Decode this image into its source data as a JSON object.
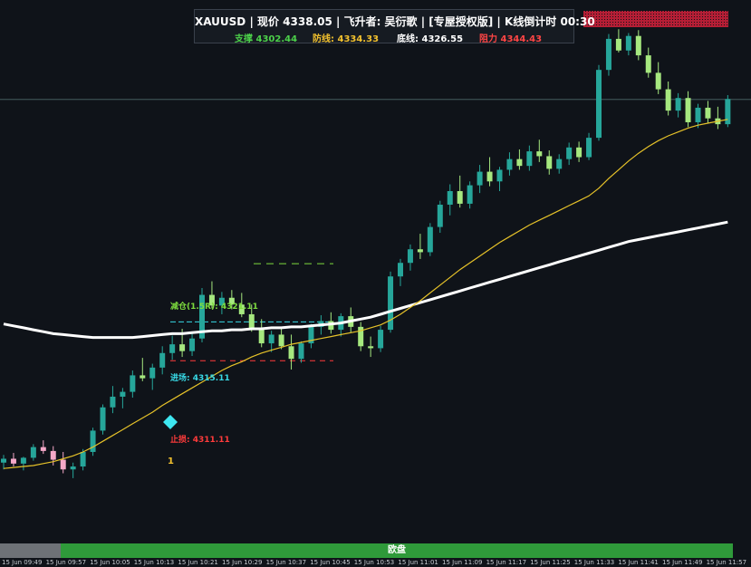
{
  "header": {
    "title": "XAUUSD | 现价 4338.05 | 飞升者: 吴衍歌 | [专屋授权版] | K线倒计时 00:30",
    "support": "支撑 4302.44",
    "defense": "防线: 4334.33",
    "bottom": "底线: 4326.55",
    "resistance": "阻力 4344.43"
  },
  "annotations": {
    "take_profit": "减仓(1.5R): 4321.11",
    "entry": "进场: 4315.11",
    "stop": "止损: 4311.11",
    "signal_number": "1"
  },
  "session": {
    "label": "欧盘"
  },
  "time_ticks": [
    "15 Jun 09:49",
    "15 Jun 09:57",
    "15 Jun 10:05",
    "15 Jun 10:13",
    "15 Jun 10:21",
    "15 Jun 10:29",
    "15 Jun 10:37",
    "15 Jun 10:45",
    "15 Jun 10:53",
    "15 Jun 11:01",
    "15 Jun 11:09",
    "15 Jun 11:17",
    "15 Jun 11:25",
    "15 Jun 11:33",
    "15 Jun 11:41",
    "15 Jun 11:49",
    "15 Jun 11:57"
  ],
  "colors": {
    "background": "#0f1319",
    "bull": "#26a69a",
    "bull_light": "#a6e87f",
    "bear_pink": "#f5a8c8",
    "ma_fast": "#e6c229",
    "ma_slow": "#ffffff",
    "entry_marker": "#3ee6f0",
    "resistance_box": "#d3213a"
  },
  "chart_data": {
    "type": "candlestick",
    "symbol": "XAUUSD",
    "current_price": 4338.05,
    "levels": {
      "take_profit": 4321.11,
      "entry": 4315.11,
      "stop": 4311.11
    },
    "candles": [
      [
        4300.6,
        4301.4,
        4299.9,
        4301.0
      ],
      [
        4301.0,
        4301.6,
        4300.2,
        4300.5
      ],
      [
        4300.5,
        4301.2,
        4299.8,
        4301.1
      ],
      [
        4301.1,
        4302.5,
        4300.8,
        4302.2
      ],
      [
        4302.2,
        4302.9,
        4301.5,
        4301.8
      ],
      [
        4301.8,
        4302.3,
        4300.3,
        4300.9
      ],
      [
        4300.9,
        4301.7,
        4299.5,
        4299.9
      ],
      [
        4299.9,
        4300.6,
        4299.0,
        4300.2
      ],
      [
        4300.2,
        4302.0,
        4299.8,
        4301.7
      ],
      [
        4301.7,
        4304.2,
        4301.3,
        4303.9
      ],
      [
        4303.9,
        4306.6,
        4303.5,
        4306.3
      ],
      [
        4306.3,
        4308.5,
        4305.7,
        4307.4
      ],
      [
        4307.4,
        4308.3,
        4306.2,
        4307.9
      ],
      [
        4307.9,
        4310.1,
        4307.3,
        4309.6
      ],
      [
        4309.6,
        4311.4,
        4309.0,
        4309.3
      ],
      [
        4309.3,
        4310.8,
        4308.1,
        4310.4
      ],
      [
        4310.4,
        4312.6,
        4309.7,
        4311.9
      ],
      [
        4311.9,
        4313.7,
        4311.2,
        4312.8
      ],
      [
        4312.8,
        4314.4,
        4311.5,
        4312.1
      ],
      [
        4312.1,
        4313.9,
        4311.6,
        4313.4
      ],
      [
        4313.4,
        4318.6,
        4313.0,
        4317.9
      ],
      [
        4317.9,
        4319.3,
        4316.5,
        4316.8
      ],
      [
        4316.8,
        4318.2,
        4315.9,
        4317.6
      ],
      [
        4317.6,
        4318.4,
        4316.4,
        4316.9
      ],
      [
        4316.9,
        4318.1,
        4315.6,
        4315.9
      ],
      [
        4315.9,
        4316.9,
        4314.1,
        4314.4
      ],
      [
        4314.4,
        4315.4,
        4312.5,
        4312.9
      ],
      [
        4312.9,
        4314.2,
        4312.0,
        4313.8
      ],
      [
        4313.8,
        4314.5,
        4312.3,
        4312.6
      ],
      [
        4312.6,
        4313.8,
        4310.2,
        4311.3
      ],
      [
        4311.3,
        4313.1,
        4310.9,
        4312.9
      ],
      [
        4312.9,
        4314.9,
        4312.4,
        4314.6
      ],
      [
        4314.6,
        4315.8,
        4313.8,
        4315.2
      ],
      [
        4315.2,
        4316.1,
        4313.9,
        4314.3
      ],
      [
        4314.3,
        4316.0,
        4313.6,
        4315.7
      ],
      [
        4315.7,
        4316.6,
        4314.0,
        4314.6
      ],
      [
        4314.6,
        4315.1,
        4312.1,
        4312.6
      ],
      [
        4312.6,
        4313.6,
        4311.5,
        4312.4
      ],
      [
        4312.4,
        4314.7,
        4312.0,
        4314.3
      ],
      [
        4314.3,
        4320.3,
        4314.0,
        4319.8
      ],
      [
        4319.8,
        4321.6,
        4318.8,
        4321.2
      ],
      [
        4321.2,
        4323.1,
        4320.4,
        4322.6
      ],
      [
        4322.6,
        4324.2,
        4321.6,
        4322.3
      ],
      [
        4322.3,
        4325.3,
        4321.9,
        4324.9
      ],
      [
        4324.9,
        4327.6,
        4324.3,
        4327.2
      ],
      [
        4327.2,
        4329.3,
        4326.1,
        4328.6
      ],
      [
        4328.6,
        4330.2,
        4326.9,
        4327.3
      ],
      [
        4327.3,
        4329.6,
        4326.8,
        4329.2
      ],
      [
        4329.2,
        4331.3,
        4328.4,
        4330.6
      ],
      [
        4330.6,
        4332.1,
        4329.1,
        4329.6
      ],
      [
        4329.6,
        4331.1,
        4328.6,
        4330.8
      ],
      [
        4330.8,
        4332.6,
        4330.2,
        4331.9
      ],
      [
        4331.9,
        4332.9,
        4330.8,
        4331.2
      ],
      [
        4331.2,
        4333.3,
        4330.7,
        4332.7
      ],
      [
        4332.7,
        4333.9,
        4331.6,
        4332.2
      ],
      [
        4332.2,
        4332.8,
        4330.3,
        4330.9
      ],
      [
        4330.9,
        4332.4,
        4330.4,
        4331.9
      ],
      [
        4331.9,
        4333.6,
        4331.3,
        4333.1
      ],
      [
        4333.1,
        4333.7,
        4331.6,
        4332.1
      ],
      [
        4332.1,
        4334.6,
        4331.8,
        4334.1
      ],
      [
        4334.1,
        4341.6,
        4333.8,
        4341.1
      ],
      [
        4341.1,
        4344.8,
        4340.5,
        4344.3
      ],
      [
        4344.3,
        4345.3,
        4342.9,
        4343.1
      ],
      [
        4343.1,
        4344.9,
        4342.6,
        4344.6
      ],
      [
        4344.6,
        4345.2,
        4342.1,
        4342.6
      ],
      [
        4342.6,
        4343.4,
        4340.3,
        4340.8
      ],
      [
        4340.8,
        4341.9,
        4338.6,
        4339.1
      ],
      [
        4339.1,
        4339.9,
        4336.4,
        4336.9
      ],
      [
        4336.9,
        4338.7,
        4336.2,
        4338.2
      ],
      [
        4338.2,
        4338.9,
        4335.2,
        4335.7
      ],
      [
        4335.7,
        4337.6,
        4335.1,
        4337.2
      ],
      [
        4337.2,
        4337.9,
        4335.6,
        4336.1
      ],
      [
        4336.1,
        4337.3,
        4335.0,
        4335.5
      ],
      [
        4335.5,
        4338.5,
        4335.2,
        4338.1
      ]
    ],
    "series": [
      {
        "values": [
          4300.0,
          4300.1,
          4300.2,
          4300.3,
          4300.5,
          4300.7,
          4301.0,
          4301.3,
          4301.7,
          4302.2,
          4302.8,
          4303.4,
          4304.0,
          4304.6,
          4305.2,
          4305.8,
          4306.5,
          4307.1,
          4307.7,
          4308.3,
          4308.9,
          4309.5,
          4310.1,
          4310.6,
          4311.0,
          4311.5,
          4311.9,
          4312.2,
          4312.5,
          4312.8,
          4313.0,
          4313.2,
          4313.4,
          4313.6,
          4313.8,
          4314.0,
          4314.2,
          4314.5,
          4314.8,
          4315.3,
          4315.9,
          4316.6,
          4317.3,
          4318.1,
          4318.9,
          4319.7,
          4320.5,
          4321.2,
          4321.9,
          4322.6,
          4323.3,
          4323.9,
          4324.5,
          4325.1,
          4325.6,
          4326.1,
          4326.6,
          4327.1,
          4327.6,
          4328.1,
          4328.9,
          4329.9,
          4330.8,
          4331.7,
          4332.5,
          4333.2,
          4333.8,
          4334.3,
          4334.7,
          4335.1,
          4335.4,
          4335.6,
          4335.8,
          4336.0
        ]
      },
      {
        "values": [
          4314.9,
          4314.7,
          4314.5,
          4314.3,
          4314.1,
          4313.9,
          4313.8,
          4313.7,
          4313.6,
          4313.5,
          4313.5,
          4313.5,
          4313.5,
          4313.5,
          4313.6,
          4313.7,
          4313.8,
          4313.9,
          4313.9,
          4314.0,
          4314.1,
          4314.2,
          4314.2,
          4314.3,
          4314.3,
          4314.4,
          4314.4,
          4314.5,
          4314.5,
          4314.6,
          4314.6,
          4314.7,
          4314.8,
          4314.9,
          4315.0,
          4315.2,
          4315.4,
          4315.6,
          4315.9,
          4316.2,
          4316.5,
          4316.8,
          4317.1,
          4317.4,
          4317.7,
          4318.0,
          4318.3,
          4318.6,
          4318.9,
          4319.2,
          4319.5,
          4319.8,
          4320.1,
          4320.4,
          4320.7,
          4321.0,
          4321.3,
          4321.6,
          4321.9,
          4322.2,
          4322.5,
          4322.8,
          4323.1,
          4323.4,
          4323.6,
          4323.8,
          4324.0,
          4324.2,
          4324.4,
          4324.6,
          4324.8,
          4325.0,
          4325.2,
          4325.4
        ]
      }
    ]
  }
}
